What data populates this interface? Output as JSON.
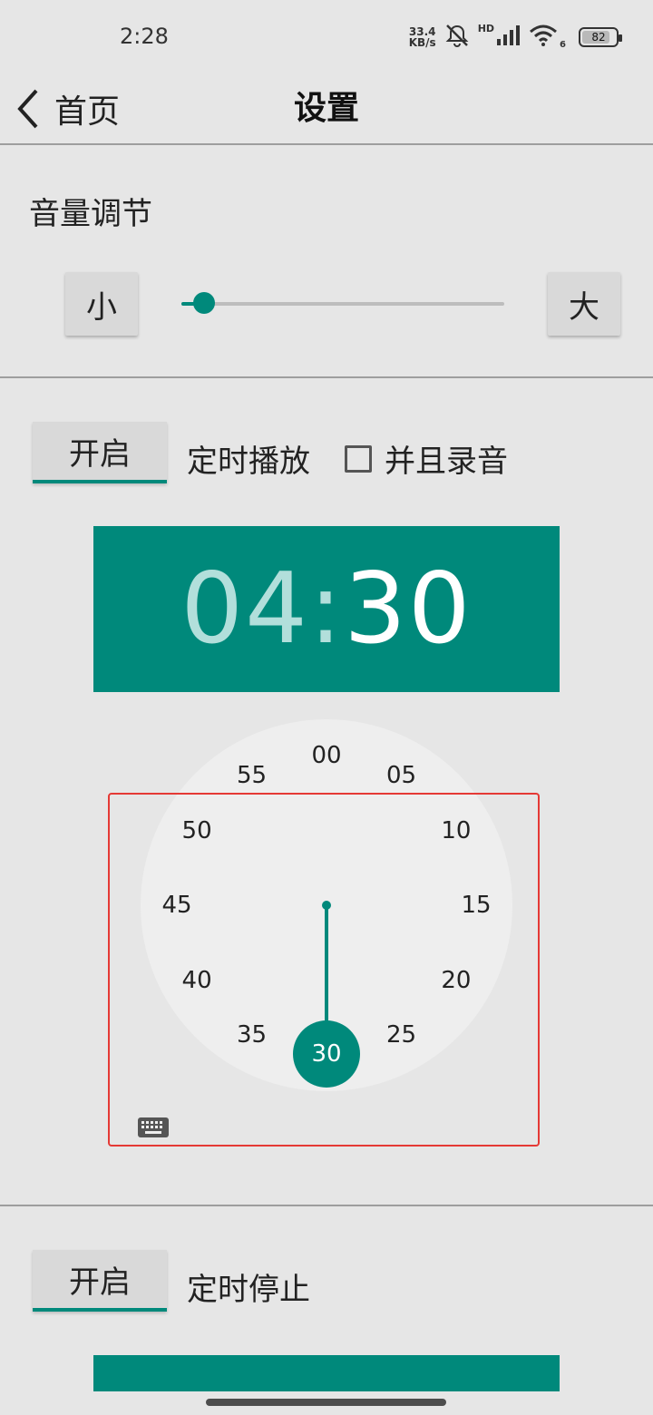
{
  "status_bar": {
    "time": "2:28",
    "net_speed_value": "33.4",
    "net_speed_unit": "KB/s",
    "hd": "HD",
    "wifi_badge": "6",
    "battery": "82"
  },
  "app_bar": {
    "back_label": "首页",
    "title": "设置"
  },
  "volume": {
    "title": "音量调节",
    "decrease_label": "小",
    "increase_label": "大",
    "level": 0.07
  },
  "timer_play": {
    "toggle_label": "开启",
    "label": "定时播放",
    "record_checkbox_label": "并且录音",
    "record_checked": false,
    "time_hour": "04",
    "time_separator": ":",
    "time_minute": "30",
    "dial_numbers": [
      "00",
      "05",
      "10",
      "15",
      "20",
      "25",
      "30",
      "35",
      "40",
      "45",
      "50",
      "55"
    ],
    "selected_minute": "30"
  },
  "timer_stop": {
    "toggle_label": "开启",
    "label": "定时停止"
  },
  "colors": {
    "accent": "#00897b",
    "highlight_box": "#e53935"
  }
}
